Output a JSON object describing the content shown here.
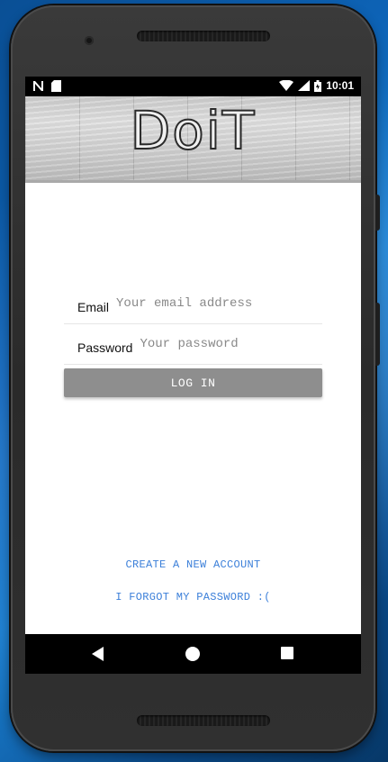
{
  "statusbar": {
    "left_icons": [
      "n-notification-icon",
      "sd-card-icon"
    ],
    "right_icons": [
      "wifi-icon",
      "signal-icon",
      "battery-icon"
    ],
    "time": "10:01"
  },
  "header": {
    "logo_text": "DoiT"
  },
  "form": {
    "email_label": "Email",
    "email_placeholder": "Your email address",
    "email_value": "",
    "password_label": "Password",
    "password_placeholder": "Your password",
    "password_value": "",
    "login_label": "LOG IN"
  },
  "links": {
    "create_account": "CREATE A NEW ACCOUNT",
    "forgot_password": "I FORGOT MY PASSWORD :("
  },
  "navbar": {
    "icons": [
      "back-icon",
      "home-icon",
      "recents-icon"
    ]
  },
  "colors": {
    "link": "#3b7fd9",
    "button": "#8e8e8e",
    "status_bar": "#000000",
    "desktop_bg": "#0d63b6"
  }
}
